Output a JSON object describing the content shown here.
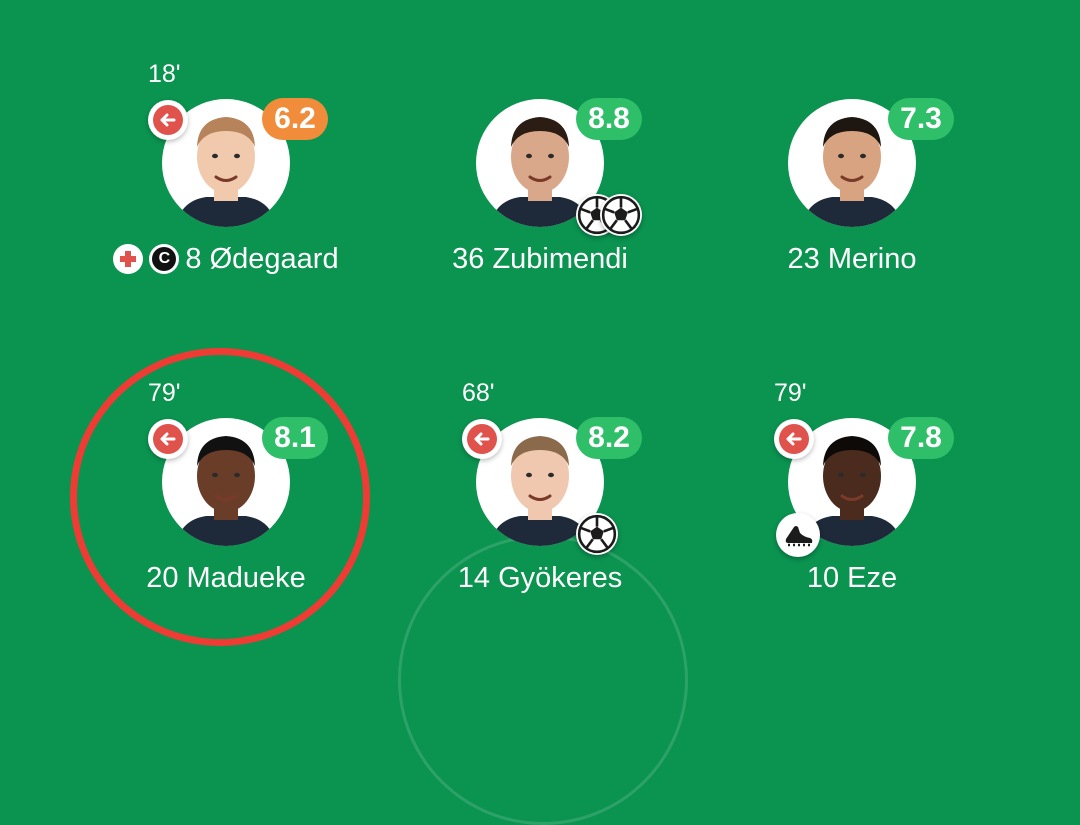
{
  "colors": {
    "pitch": "#0b9350",
    "rating_orange": "#f08c3a",
    "rating_green": "#2fbf68",
    "sub_red": "#e0524c",
    "highlight": "#ee3c35"
  },
  "players": [
    {
      "sub_time": "18'",
      "rating": "6.2",
      "rating_color": "#f08c3a",
      "name": "8 Ødegaard",
      "subbed_off": true,
      "captain": true,
      "injured": true
    },
    {
      "sub_time": "",
      "rating": "8.8",
      "rating_color": "#2fbf68",
      "name": "36 Zubimendi",
      "goals": 2
    },
    {
      "sub_time": "",
      "rating": "7.3",
      "rating_color": "#2fbf68",
      "name": "23 Merino"
    },
    {
      "sub_time": "79'",
      "rating": "8.1",
      "rating_color": "#2fbf68",
      "name": "20 Madueke",
      "subbed_off": true,
      "highlighted": true
    },
    {
      "sub_time": "68'",
      "rating": "8.2",
      "rating_color": "#2fbf68",
      "name": "14 Gyökeres",
      "subbed_off": true,
      "goals": 1
    },
    {
      "sub_time": "79'",
      "rating": "7.8",
      "rating_color": "#2fbf68",
      "name": "10 Eze",
      "subbed_off": true,
      "assist_icon": "boot-icon"
    }
  ],
  "badges": {
    "captain_label": "C",
    "injury_icon": "injury-cross-icon",
    "sub_icon": "substitution-arrow-icon",
    "goal_icon": "football-icon"
  }
}
